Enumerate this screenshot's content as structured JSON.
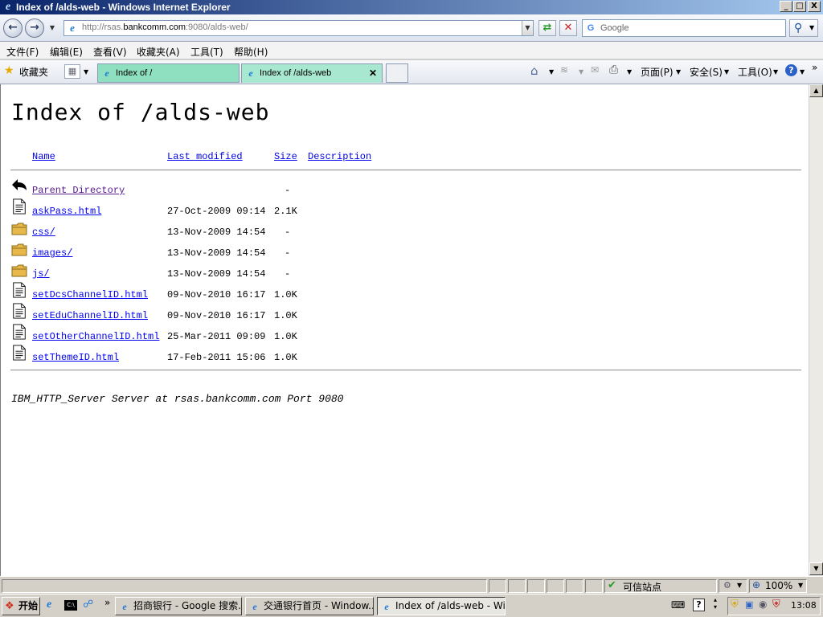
{
  "window": {
    "title": "Index of /alds-web - Windows Internet Explorer",
    "controls": [
      "_",
      "□",
      "X"
    ]
  },
  "address": {
    "url_prefix": "http://rsas.",
    "url_domain": "bankcomm.com",
    "url_suffix": ":9080/alds-web/",
    "search_placeholder": "Google"
  },
  "menu": [
    "文件(F)",
    "编辑(E)",
    "查看(V)",
    "收藏夹(A)",
    "工具(T)",
    "帮助(H)"
  ],
  "toolbar": {
    "favorites": "收藏夹",
    "tabs": [
      {
        "label": "Index of /"
      },
      {
        "label": "Index of /alds-web"
      }
    ],
    "page": "页面(P)",
    "safety": "安全(S)",
    "tools": "工具(O)"
  },
  "page": {
    "heading": "Index of /alds-web",
    "columns": {
      "name": "Name",
      "modified": "Last modified",
      "size": "Size",
      "description": "Description"
    },
    "parent": {
      "name": "Parent Directory",
      "size": "-"
    },
    "entries": [
      {
        "name": "askPass.html",
        "date": "27-Oct-2009 09:14",
        "size": "2.1K",
        "type": "file"
      },
      {
        "name": "css/",
        "date": "13-Nov-2009 14:54",
        "size": "-",
        "type": "folder"
      },
      {
        "name": "images/",
        "date": "13-Nov-2009 14:54",
        "size": "-",
        "type": "folder"
      },
      {
        "name": "js/",
        "date": "13-Nov-2009 14:54",
        "size": "-",
        "type": "folder"
      },
      {
        "name": "setDcsChannelID.html",
        "date": "09-Nov-2010 16:17",
        "size": "1.0K",
        "type": "file"
      },
      {
        "name": "setEduChannelID.html",
        "date": "09-Nov-2010 16:17",
        "size": "1.0K",
        "type": "file"
      },
      {
        "name": "setOtherChannelID.html",
        "date": "25-Mar-2011 09:09",
        "size": "1.0K",
        "type": "file"
      },
      {
        "name": "setThemeID.html",
        "date": "17-Feb-2011 15:06",
        "size": "1.0K",
        "type": "file"
      }
    ],
    "server_address": "IBM_HTTP_Server Server at rsas.bankcomm.com Port 9080"
  },
  "status": {
    "zone": "可信站点",
    "zoom": "100%"
  },
  "taskbar": {
    "start": "开始",
    "windows": [
      {
        "label": "招商银行 - Google 搜索..."
      },
      {
        "label": "交通银行首页 - Window..."
      },
      {
        "label": "Index of /alds-web - Win..."
      }
    ],
    "clock": "13:08"
  }
}
